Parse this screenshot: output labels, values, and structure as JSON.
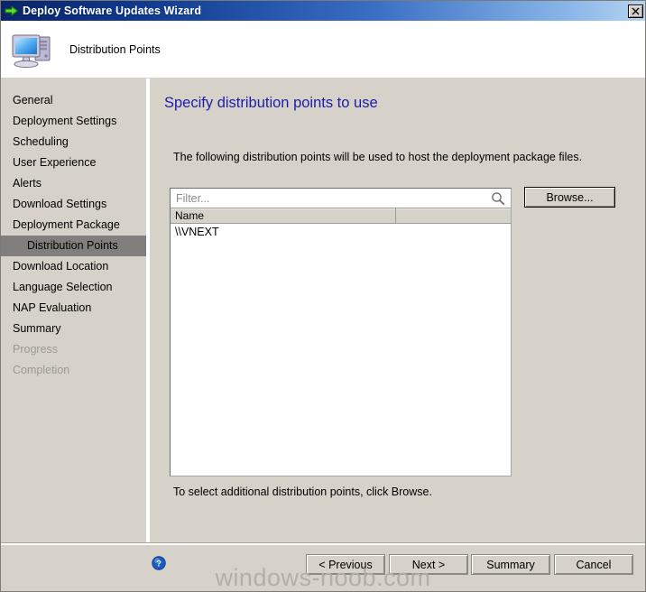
{
  "window": {
    "title": "Deploy Software Updates Wizard",
    "title_icon": "green-arrow-icon",
    "close_label": "✕",
    "titlebar_gradient_start": "#0a246a",
    "titlebar_gradient_end": "#b6d4f2"
  },
  "header": {
    "icon": "computer-icon",
    "title": "Distribution Points"
  },
  "sidebar": {
    "items": [
      {
        "label": "General",
        "state": "normal"
      },
      {
        "label": "Deployment Settings",
        "state": "normal"
      },
      {
        "label": "Scheduling",
        "state": "normal"
      },
      {
        "label": "User Experience",
        "state": "normal"
      },
      {
        "label": "Alerts",
        "state": "normal"
      },
      {
        "label": "Download Settings",
        "state": "normal"
      },
      {
        "label": "Deployment Package",
        "state": "normal"
      },
      {
        "label": "Distribution Points",
        "state": "selected"
      },
      {
        "label": "Download Location",
        "state": "normal"
      },
      {
        "label": "Language Selection",
        "state": "normal"
      },
      {
        "label": "NAP Evaluation",
        "state": "normal"
      },
      {
        "label": "Summary",
        "state": "normal"
      },
      {
        "label": "Progress",
        "state": "disabled"
      },
      {
        "label": "Completion",
        "state": "disabled"
      }
    ],
    "selected_color": "#807f7d",
    "disabled_color": "#9a9a95"
  },
  "main": {
    "heading": "Specify distribution points to use",
    "heading_color": "#1d1da8",
    "intro": "The following distribution points will be used to host the deployment package files.",
    "filter": {
      "value": "",
      "placeholder": "Filter...",
      "icon": "search-icon"
    },
    "table": {
      "columns": [
        "Name",
        ""
      ],
      "rows": [
        {
          "name": "\\\\VNEXT"
        }
      ]
    },
    "footer_note": "To select additional distribution points, click Browse.",
    "browse_label": "Browse..."
  },
  "bottom": {
    "help_icon": "help-question-icon",
    "buttons": [
      {
        "id": "previous",
        "label": "< Previous"
      },
      {
        "id": "next",
        "label": "Next >"
      },
      {
        "id": "summary",
        "label": "Summary"
      },
      {
        "id": "cancel",
        "label": "Cancel"
      }
    ]
  },
  "watermark": {
    "text": "windows-noob.com",
    "color": "#b3afa8"
  }
}
